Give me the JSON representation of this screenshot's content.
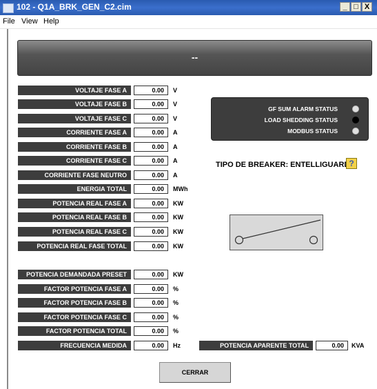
{
  "window": {
    "title": "102 - Q1A_BRK_GEN_C2.cim",
    "minimize_label": "_",
    "maximize_label": "□",
    "close_label": "X"
  },
  "menu": [
    {
      "label": "File"
    },
    {
      "label": "View"
    },
    {
      "label": "Help"
    }
  ],
  "header": {
    "text": "--"
  },
  "readings_group1": [
    {
      "label": "VOLTAJE FASE A",
      "value": "0.00",
      "unit": "V"
    },
    {
      "label": "VOLTAJE FASE B",
      "value": "0.00",
      "unit": "V"
    },
    {
      "label": "VOLTAJE FASE C",
      "value": "0.00",
      "unit": "V"
    },
    {
      "label": "CORRIENTE FASE A",
      "value": "0.00",
      "unit": "A"
    },
    {
      "label": "CORRIENTE FASE B",
      "value": "0.00",
      "unit": "A"
    },
    {
      "label": "CORRIENTE FASE C",
      "value": "0.00",
      "unit": "A"
    },
    {
      "label": "CORRIENTE FASE NEUTRO",
      "value": "0.00",
      "unit": "A"
    },
    {
      "label": "ENERGIA TOTAL",
      "value": "0.00",
      "unit": "MWh"
    },
    {
      "label": "POTENCIA REAL FASE A",
      "value": "0.00",
      "unit": "KW"
    },
    {
      "label": "POTENCIA REAL FASE B",
      "value": "0.00",
      "unit": "KW"
    },
    {
      "label": "POTENCIA REAL FASE C",
      "value": "0.00",
      "unit": "KW"
    },
    {
      "label": "POTENCIA REAL FASE TOTAL",
      "value": "0.00",
      "unit": "KW"
    }
  ],
  "readings_group2": [
    {
      "label": "POTENCIA DEMANDADA PRESET",
      "value": "0.00",
      "unit": "KW"
    },
    {
      "label": "FACTOR POTENCIA FASE A",
      "value": "0.00",
      "unit": "%"
    },
    {
      "label": "FACTOR POTENCIA FASE B",
      "value": "0.00",
      "unit": "%"
    },
    {
      "label": "FACTOR POTENCIA FASE C",
      "value": "0.00",
      "unit": "%"
    },
    {
      "label": "FACTOR POTENCIA TOTAL",
      "value": "0.00",
      "unit": "%"
    },
    {
      "label": "FRECUENCIA MEDIDA",
      "value": "0.00",
      "unit": "Hz"
    }
  ],
  "apparent_power": {
    "label": "POTENCIA APARENTE TOTAL",
    "value": "0.00",
    "unit": "KVA"
  },
  "status": [
    {
      "label": "GF SUM ALARM STATUS",
      "color": "#e0e0e0"
    },
    {
      "label": "LOAD SHEDDING STATUS",
      "color": "#000000"
    },
    {
      "label": "MODBUS STATUS",
      "color": "#e0e0e0"
    }
  ],
  "breaker": {
    "title": "TIPO DE BREAKER: ENTELLIGUARD",
    "help_icon": "question-mark-icon"
  },
  "close_button": {
    "label": "CERRAR"
  }
}
